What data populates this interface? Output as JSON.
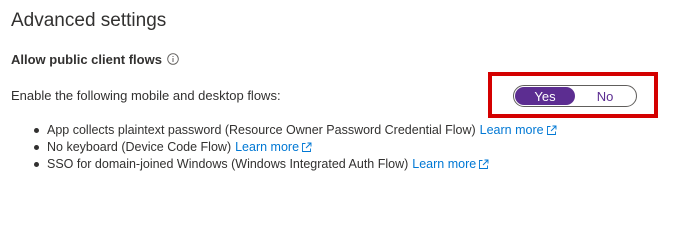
{
  "section": {
    "title": "Advanced settings"
  },
  "public_client": {
    "heading": "Allow public client flows",
    "info_icon": "info-icon",
    "flows_label": "Enable the following mobile and desktop flows:",
    "toggle": {
      "yes_label": "Yes",
      "no_label": "No",
      "selected": "Yes",
      "selected_color": "#5c2d91",
      "highlight_color": "#d40000"
    }
  },
  "flows": [
    {
      "text": "App collects plaintext password (Resource Owner Password Credential Flow)",
      "link": "Learn more",
      "link_icon": "external-link-icon"
    },
    {
      "text": "No keyboard (Device Code Flow)",
      "link": "Learn more",
      "link_icon": "external-link-icon"
    },
    {
      "text": "SSO for domain-joined Windows (Windows Integrated Auth Flow)",
      "link": "Learn more",
      "link_icon": "external-link-icon"
    }
  ],
  "colors": {
    "link": "#0078d4",
    "text": "#323130"
  }
}
